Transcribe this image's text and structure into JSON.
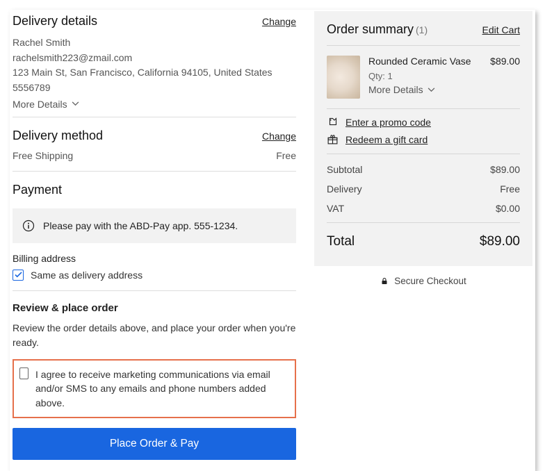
{
  "delivery": {
    "heading": "Delivery details",
    "change": "Change",
    "name": "Rachel Smith",
    "email": "rachelsmith223@zmail.com",
    "address": "123 Main St, San Francisco, California 94105, United States",
    "phone": "5556789",
    "more": "More Details"
  },
  "method": {
    "heading": "Delivery method",
    "change": "Change",
    "name": "Free Shipping",
    "cost": "Free"
  },
  "payment": {
    "heading": "Payment",
    "banner": "Please pay with the ABD-Pay app.  555-1234.",
    "billing_heading": "Billing address",
    "same_as": "Same as delivery address"
  },
  "review": {
    "heading": "Review & place order",
    "prompt": "Review the order details above, and place your order when you're ready.",
    "consent": "I agree to receive marketing communications via email and/or SMS to any emails and phone numbers added above.",
    "button": "Place Order & Pay"
  },
  "summary": {
    "heading": "Order summary",
    "count": "(1)",
    "edit": "Edit Cart",
    "item_name": "Rounded Ceramic Vase",
    "item_price": "$89.00",
    "qty": "Qty: 1",
    "more": "More Details",
    "promo": "Enter a promo code",
    "gift": "Redeem a gift card",
    "subtotal_label": "Subtotal",
    "subtotal": "$89.00",
    "delivery_label": "Delivery",
    "delivery": "Free",
    "vat_label": "VAT",
    "vat": "$0.00",
    "total_label": "Total",
    "total": "$89.00",
    "secure": "Secure Checkout"
  }
}
